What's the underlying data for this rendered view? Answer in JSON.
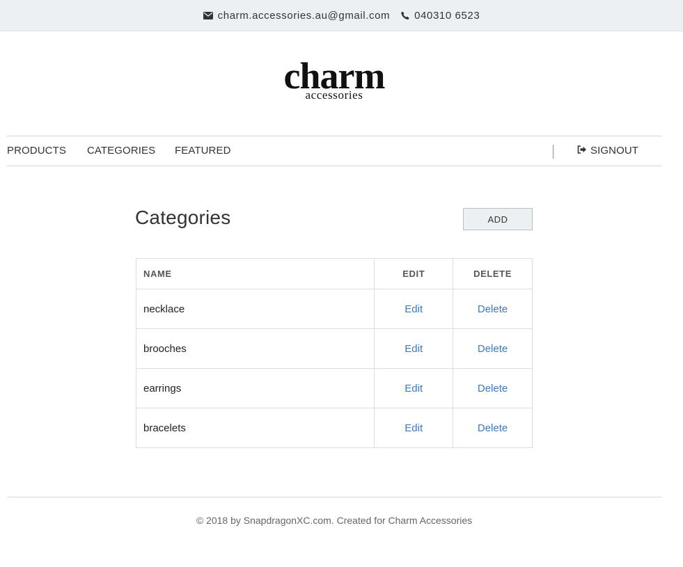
{
  "contact": {
    "email": "charm.accessories.au@gmail.com",
    "phone": "040310 6523",
    "email_icon": "envelope-icon",
    "phone_icon": "phone-icon"
  },
  "logo": {
    "word": "charm",
    "sub": "accessories"
  },
  "nav": {
    "items": [
      {
        "label": "PRODUCTS"
      },
      {
        "label": "CATEGORIES"
      },
      {
        "label": "FEATURED"
      }
    ],
    "signout_label": "SIGNOUT",
    "signout_icon": "sign-out-icon"
  },
  "page": {
    "title": "Categories",
    "add_label": "ADD"
  },
  "table": {
    "headers": [
      "NAME",
      "EDIT",
      "DELETE"
    ],
    "rows": [
      {
        "name": "necklace",
        "edit": "Edit",
        "delete": "Delete"
      },
      {
        "name": "brooches",
        "edit": "Edit",
        "delete": "Delete"
      },
      {
        "name": "earrings",
        "edit": "Edit",
        "delete": "Delete"
      },
      {
        "name": "bracelets",
        "edit": "Edit",
        "delete": "Delete"
      }
    ]
  },
  "footer": {
    "text": "© 2018 by SnapdragonXC.com. Created for Charm Accessories"
  },
  "colors": {
    "topbar_bg": "#ecf0f3",
    "link": "#3a7bbf",
    "button_bg": "#ecf0f3"
  }
}
